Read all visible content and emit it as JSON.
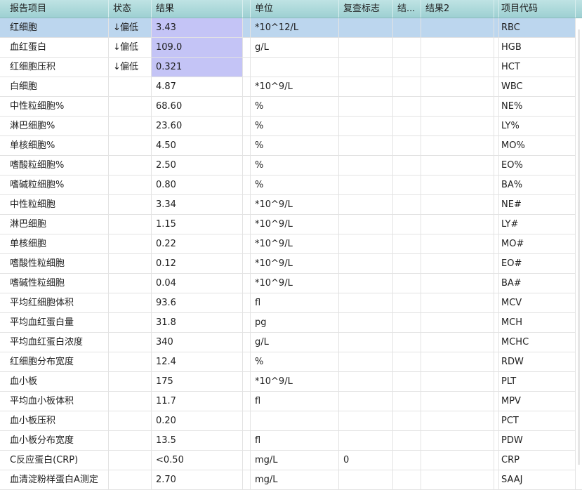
{
  "columns": [
    {
      "label": "报告项目"
    },
    {
      "label": "状态"
    },
    {
      "label": "结果"
    },
    {
      "label": ""
    },
    {
      "label": "单位"
    },
    {
      "label": "复查标志"
    },
    {
      "label": "结..."
    },
    {
      "label": "结果2"
    },
    {
      "label": ""
    },
    {
      "label": "项目代码"
    }
  ],
  "status_arrow": "↓",
  "rows": [
    {
      "name": "红细胞",
      "status": "偏低",
      "result": "3.43",
      "unit": "*10^12/L",
      "recheck": "",
      "code": "RBC",
      "flagged": true,
      "selected": true
    },
    {
      "name": "血红蛋白",
      "status": "偏低",
      "result": "109.0",
      "unit": "g/L",
      "recheck": "",
      "code": "HGB",
      "flagged": true,
      "selected": false
    },
    {
      "name": "红细胞压积",
      "status": "偏低",
      "result": "0.321",
      "unit": "",
      "recheck": "",
      "code": "HCT",
      "flagged": true,
      "selected": false
    },
    {
      "name": "白细胞",
      "status": "",
      "result": "4.87",
      "unit": "*10^9/L",
      "recheck": "",
      "code": "WBC",
      "flagged": false,
      "selected": false
    },
    {
      "name": "中性粒细胞%",
      "status": "",
      "result": "68.60",
      "unit": "%",
      "recheck": "",
      "code": "NE%",
      "flagged": false,
      "selected": false
    },
    {
      "name": "淋巴细胞%",
      "status": "",
      "result": "23.60",
      "unit": "%",
      "recheck": "",
      "code": "LY%",
      "flagged": false,
      "selected": false
    },
    {
      "name": "单核细胞%",
      "status": "",
      "result": "4.50",
      "unit": "%",
      "recheck": "",
      "code": "MO%",
      "flagged": false,
      "selected": false
    },
    {
      "name": "嗜酸粒细胞%",
      "status": "",
      "result": "2.50",
      "unit": "%",
      "recheck": "",
      "code": "EO%",
      "flagged": false,
      "selected": false
    },
    {
      "name": "嗜碱粒细胞%",
      "status": "",
      "result": "0.80",
      "unit": "%",
      "recheck": "",
      "code": "BA%",
      "flagged": false,
      "selected": false
    },
    {
      "name": "中性粒细胞",
      "status": "",
      "result": "3.34",
      "unit": "*10^9/L",
      "recheck": "",
      "code": "NE#",
      "flagged": false,
      "selected": false
    },
    {
      "name": "淋巴细胞",
      "status": "",
      "result": "1.15",
      "unit": "*10^9/L",
      "recheck": "",
      "code": "LY#",
      "flagged": false,
      "selected": false
    },
    {
      "name": "单核细胞",
      "status": "",
      "result": "0.22",
      "unit": "*10^9/L",
      "recheck": "",
      "code": "MO#",
      "flagged": false,
      "selected": false
    },
    {
      "name": "嗜酸性粒细胞",
      "status": "",
      "result": "0.12",
      "unit": "*10^9/L",
      "recheck": "",
      "code": "EO#",
      "flagged": false,
      "selected": false
    },
    {
      "name": "嗜碱性粒细胞",
      "status": "",
      "result": "0.04",
      "unit": "*10^9/L",
      "recheck": "",
      "code": "BA#",
      "flagged": false,
      "selected": false
    },
    {
      "name": "平均红细胞体积",
      "status": "",
      "result": "93.6",
      "unit": "fl",
      "recheck": "",
      "code": "MCV",
      "flagged": false,
      "selected": false
    },
    {
      "name": "平均血红蛋白量",
      "status": "",
      "result": "31.8",
      "unit": "pg",
      "recheck": "",
      "code": "MCH",
      "flagged": false,
      "selected": false
    },
    {
      "name": "平均血红蛋白浓度",
      "status": "",
      "result": "340",
      "unit": "g/L",
      "recheck": "",
      "code": "MCHC",
      "flagged": false,
      "selected": false
    },
    {
      "name": "红细胞分布宽度",
      "status": "",
      "result": "12.4",
      "unit": "%",
      "recheck": "",
      "code": "RDW",
      "flagged": false,
      "selected": false
    },
    {
      "name": "血小板",
      "status": "",
      "result": "175",
      "unit": "*10^9/L",
      "recheck": "",
      "code": "PLT",
      "flagged": false,
      "selected": false
    },
    {
      "name": "平均血小板体积",
      "status": "",
      "result": "11.7",
      "unit": "fl",
      "recheck": "",
      "code": "MPV",
      "flagged": false,
      "selected": false
    },
    {
      "name": "血小板压积",
      "status": "",
      "result": "0.20",
      "unit": "",
      "recheck": "",
      "code": "PCT",
      "flagged": false,
      "selected": false
    },
    {
      "name": "血小板分布宽度",
      "status": "",
      "result": "13.5",
      "unit": "fl",
      "recheck": "",
      "code": "PDW",
      "flagged": false,
      "selected": false
    },
    {
      "name": "C反应蛋白(CRP)",
      "status": "",
      "result": "<0.50",
      "unit": "mg/L",
      "recheck": "0",
      "code": "CRP",
      "flagged": false,
      "selected": false
    },
    {
      "name": "血清淀粉样蛋白A测定",
      "status": "",
      "result": "2.70",
      "unit": "mg/L",
      "recheck": "",
      "code": "SAAJ",
      "flagged": false,
      "selected": false
    }
  ],
  "colors": {
    "header_top": "#bfe3e4",
    "header_bottom": "#9dd0d2",
    "selected_row": "#bcd6ee",
    "flagged_result": "#c4c4f6",
    "grid_line": "#e3e3e3"
  }
}
